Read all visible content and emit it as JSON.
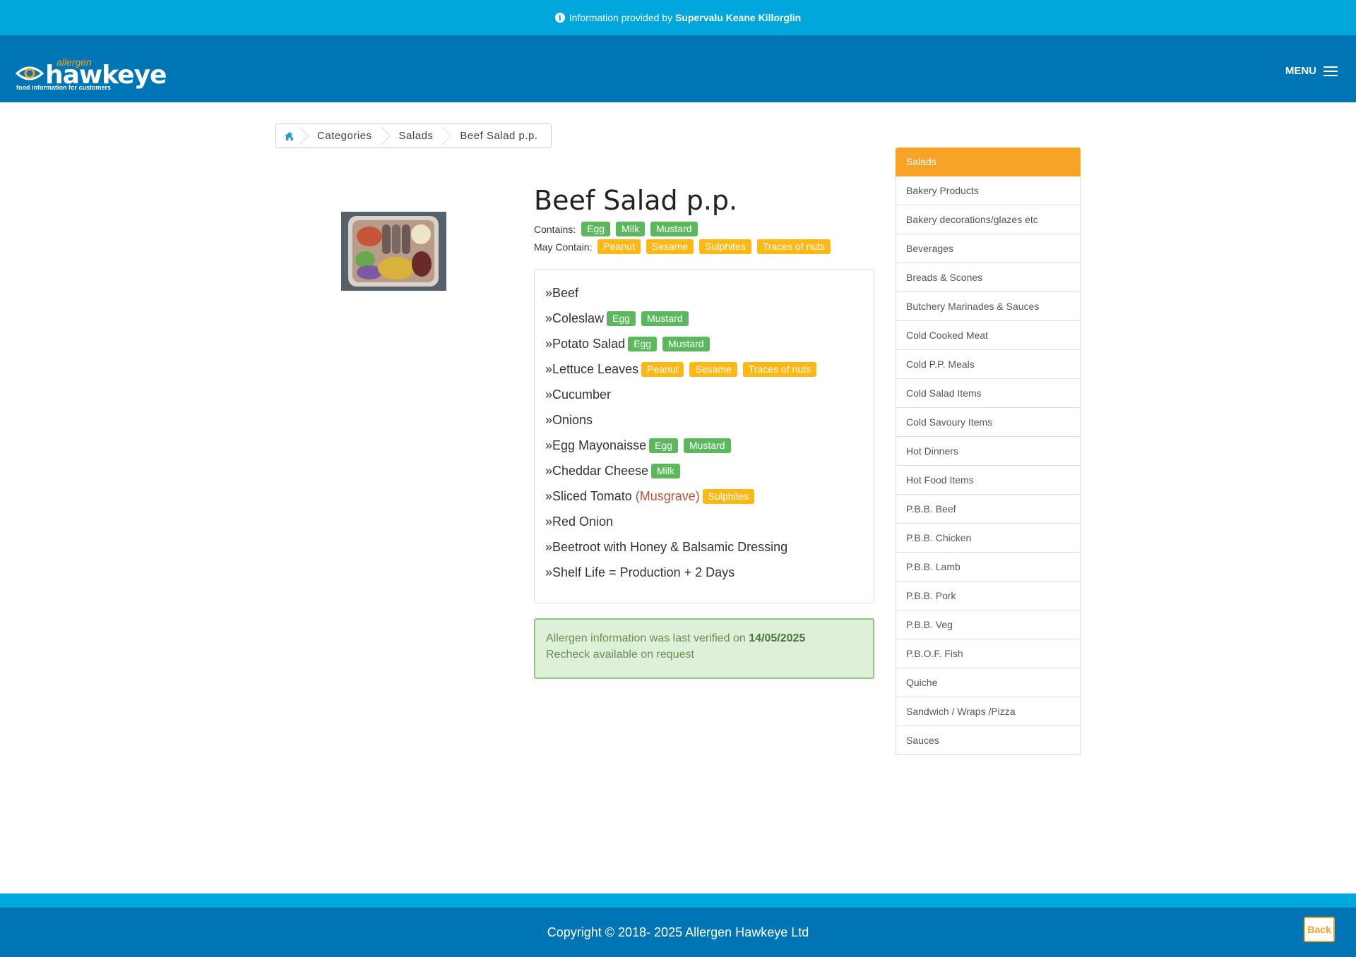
{
  "info_bar": {
    "prefix": "Information provided by",
    "provider": "Supervalu Keane Killorglin"
  },
  "header": {
    "logo": {
      "small": "allergen",
      "big": "hawkeye",
      "tagline": "food information for customers"
    },
    "menu_label": "MENU"
  },
  "breadcrumb": {
    "items": [
      "Categories",
      "Salads",
      "Beef Salad p.p."
    ]
  },
  "product": {
    "title": "Beef Salad p.p.",
    "contains_label": "Contains:",
    "contains": [
      "Egg",
      "Milk",
      "Mustard"
    ],
    "may_contain_label": "May Contain:",
    "may_contain": [
      "Peanut",
      "Sesame",
      "Sulphites",
      "Traces of nuts"
    ]
  },
  "ingredients": [
    {
      "name": "»Beef",
      "supplier": "",
      "contains": [],
      "may": []
    },
    {
      "name": "»Coleslaw",
      "supplier": "",
      "contains": [
        "Egg",
        "Mustard"
      ],
      "may": []
    },
    {
      "name": "»Potato Salad",
      "supplier": "",
      "contains": [
        "Egg",
        "Mustard"
      ],
      "may": []
    },
    {
      "name": "»Lettuce Leaves",
      "supplier": "",
      "contains": [],
      "may": [
        "Peanut",
        "Sesame",
        "Traces of nuts"
      ]
    },
    {
      "name": "»Cucumber",
      "supplier": "",
      "contains": [],
      "may": []
    },
    {
      "name": "»Onions",
      "supplier": "",
      "contains": [],
      "may": []
    },
    {
      "name": "»Egg Mayonaisse",
      "supplier": "",
      "contains": [
        "Egg",
        "Mustard"
      ],
      "may": []
    },
    {
      "name": "»Cheddar Cheese",
      "supplier": "",
      "contains": [
        "Milk"
      ],
      "may": []
    },
    {
      "name": "»Sliced Tomato",
      "supplier": "(Musgrave)",
      "contains": [],
      "may": [
        "Sulphites"
      ]
    },
    {
      "name": "»Red Onion",
      "supplier": "",
      "contains": [],
      "may": []
    },
    {
      "name": "»Beetroot with Honey & Balsamic Dressing",
      "supplier": "",
      "contains": [],
      "may": []
    },
    {
      "name": "»Shelf Life = Production + 2 Days",
      "supplier": "",
      "contains": [],
      "may": []
    }
  ],
  "verification": {
    "text": "Allergen information was last verified on",
    "date": "14/05/2025",
    "note": "Recheck available on request"
  },
  "sidebar": {
    "active": "Salads",
    "items": [
      "Bakery Products",
      "Bakery decorations/glazes etc",
      "Beverages",
      "Breads & Scones",
      "Butchery Marinades & Sauces",
      "Cold Cooked Meat",
      "Cold P.P. Meals",
      "Cold Salad Items",
      "Cold Savoury Items",
      "Hot Dinners",
      "Hot Food Items",
      "P.B.B. Beef",
      "P.B.B. Chicken",
      "P.B.B. Lamb",
      "P.B.B. Pork",
      "P.B.B. Veg",
      "P.B.O.F. Fish",
      "Quiche",
      "Sandwich / Wraps /Pizza",
      "Sauces"
    ]
  },
  "footer": {
    "copyright": "Copyright © 2018- 2025 Allergen Hawkeye Ltd",
    "back_label": "Back"
  },
  "colors": {
    "header": "#0075b5",
    "info_bar": "#00a6dc",
    "accent": "#f7a326",
    "contains_badge": "#5cb85c",
    "may_badge": "#fcb814"
  }
}
